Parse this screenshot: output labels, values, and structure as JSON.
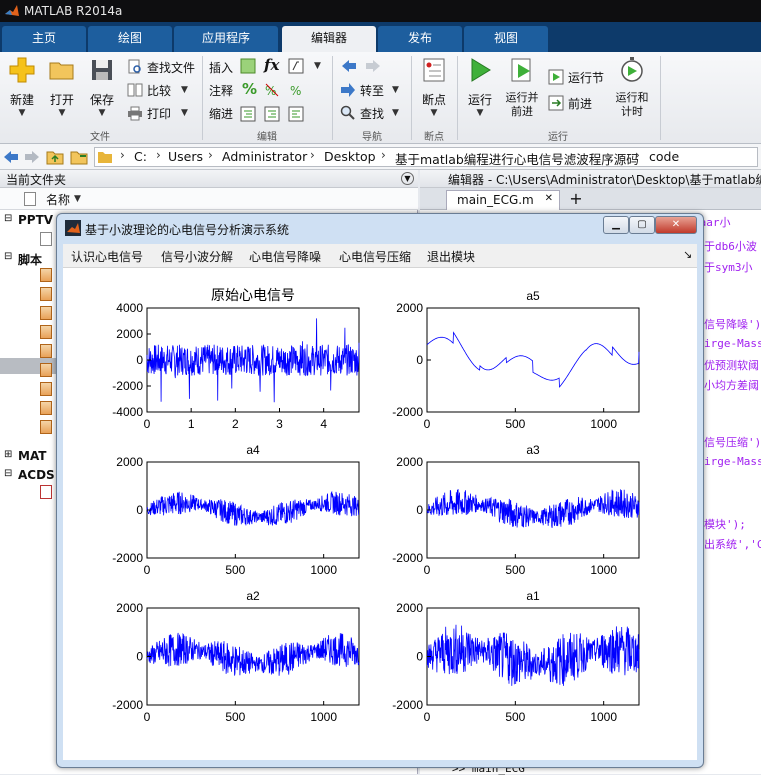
{
  "app": {
    "title": "MATLAB R2014a"
  },
  "tabs": [
    {
      "label": "主页"
    },
    {
      "label": "绘图"
    },
    {
      "label": "应用程序"
    },
    {
      "label": "编辑器"
    },
    {
      "label": "发布"
    },
    {
      "label": "视图"
    }
  ],
  "ribbon": {
    "file": {
      "group": "文件",
      "new": "新建",
      "open": "打开",
      "save": "保存",
      "find_files": "查找文件",
      "compare": "比较",
      "print": "打印"
    },
    "edit": {
      "group": "编辑",
      "insert": "插入",
      "comment": "注释",
      "indent": "缩进",
      "fx": "fx"
    },
    "nav": {
      "group": "导航",
      "goto": "转至",
      "find": "查找"
    },
    "breakpoints": {
      "group": "断点",
      "label": "断点"
    },
    "run": {
      "group": "运行",
      "run": "运行",
      "run_advance": "运行并前进",
      "run_section": "运行节",
      "advance": "前进",
      "run_time": "运行和计时"
    }
  },
  "address": {
    "path": [
      "C:",
      "Users",
      "Administrator",
      "Desktop",
      "基于matlab编程进行心电信号滤波程序源码",
      "code"
    ]
  },
  "current_folder": {
    "title": "当前文件夹",
    "col_name": "名称",
    "groups": [
      {
        "label": "PPTV"
      },
      {
        "label": "脚本"
      },
      {
        "label": "MAT"
      },
      {
        "label": "ACDS"
      }
    ]
  },
  "editor": {
    "title": "编辑器 - C:\\Users\\Administrator\\Desktop\\基于matlab编",
    "tab": "main_ECG.m",
    "lines": [
      "于Haar小",
      "于db6小波",
      "于sym3小",
      "信号降噪');",
      "irge-Mass",
      "优预测软阈",
      "小均方差阈",
      "信号压缩');",
      "irge-Mass",
      "模块');",
      "出系统','C"
    ],
    "cmd": ">> main_ECG"
  },
  "figure": {
    "title": "基于小波理论的心电信号分析演示系统",
    "menu": [
      "认识心电信号",
      "信号小波分解",
      "心电信号降噪",
      "心电信号压缩",
      "退出模块"
    ],
    "plots": [
      {
        "title": "原始心电信号",
        "yticks": [
          "4000",
          "2000",
          "0",
          "-2000",
          "-4000"
        ],
        "xticks": [
          "0",
          "1",
          "2",
          "3",
          "4"
        ]
      },
      {
        "title": "a5",
        "yticks": [
          "2000",
          "0",
          "-2000"
        ],
        "xticks": [
          "0",
          "500",
          "1000"
        ]
      },
      {
        "title": "a4",
        "yticks": [
          "2000",
          "0",
          "-2000"
        ],
        "xticks": [
          "0",
          "500",
          "1000"
        ]
      },
      {
        "title": "a3",
        "yticks": [
          "2000",
          "0",
          "-2000"
        ],
        "xticks": [
          "0",
          "500",
          "1000"
        ]
      },
      {
        "title": "a2",
        "yticks": [
          "2000",
          "0",
          "-2000"
        ],
        "xticks": [
          "0",
          "500",
          "1000"
        ]
      },
      {
        "title": "a1",
        "yticks": [
          "2000",
          "0",
          "-2000"
        ],
        "xticks": [
          "0",
          "500",
          "1000"
        ]
      }
    ],
    "line_color": "#0000ff"
  },
  "chart_data": [
    {
      "type": "line",
      "title": "原始心电信号",
      "xlim": [
        0,
        4.8
      ],
      "ylim": [
        -4000,
        4000
      ]
    },
    {
      "type": "line",
      "title": "a5",
      "xlim": [
        0,
        1200
      ],
      "ylim": [
        -2000,
        2000
      ]
    },
    {
      "type": "line",
      "title": "a4",
      "xlim": [
        0,
        1200
      ],
      "ylim": [
        -2000,
        2000
      ]
    },
    {
      "type": "line",
      "title": "a3",
      "xlim": [
        0,
        1200
      ],
      "ylim": [
        -2000,
        2000
      ]
    },
    {
      "type": "line",
      "title": "a2",
      "xlim": [
        0,
        1200
      ],
      "ylim": [
        -2000,
        2000
      ]
    },
    {
      "type": "line",
      "title": "a1",
      "xlim": [
        0,
        1200
      ],
      "ylim": [
        -2000,
        2000
      ]
    }
  ]
}
